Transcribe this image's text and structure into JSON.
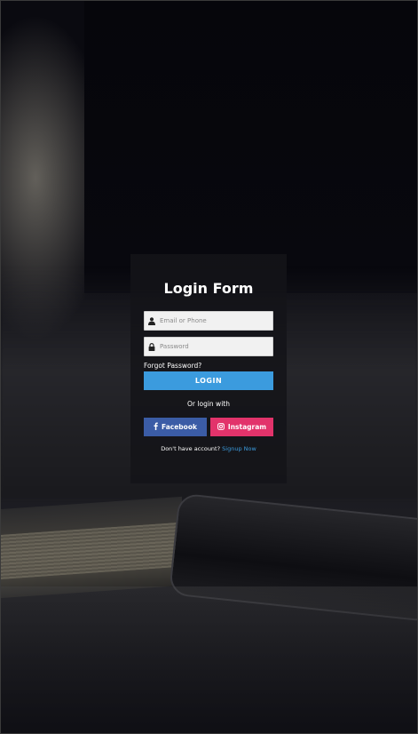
{
  "form": {
    "title": "Login Form",
    "email": {
      "placeholder": "Email or Phone",
      "value": "",
      "icon": "user-icon"
    },
    "password": {
      "placeholder": "Password",
      "value": "",
      "icon": "lock-icon"
    },
    "forgot_label": "Forgot Password?",
    "login_label": "LOGIN",
    "or_label": "Or login with",
    "facebook_label": "Facebook",
    "instagram_label": "Instagram",
    "signup_prompt": "Don't have account?",
    "signup_link": "Signup Now"
  },
  "colors": {
    "accent": "#3b9bde",
    "facebook": "#3b5ca6",
    "instagram": "#e2336b",
    "card_bg": "#141418"
  }
}
